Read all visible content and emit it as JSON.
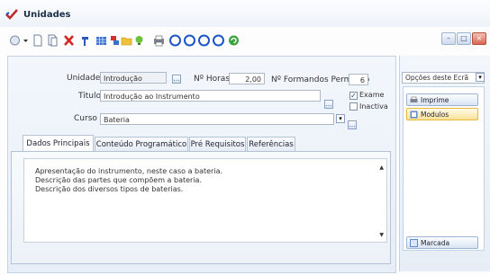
{
  "window": {
    "title": "Unidades"
  },
  "toolbar": {
    "icons": [
      "disc-icon",
      "dropdown-arrow-icon",
      "new-document-icon",
      "copy-document-icon",
      "delete-icon",
      "hammer-icon",
      "calendar-grid-icon",
      "report-icon",
      "folder-icon",
      "bulb-icon",
      "print-icon",
      "nav-first-icon",
      "nav-prev-icon",
      "nav-next-icon",
      "nav-last-icon",
      "refresh-icon"
    ]
  },
  "window_controls": {
    "minimize": "–",
    "maximize": "□",
    "close": "×"
  },
  "form": {
    "unidade_label": "Unidade",
    "unidade_value": "Introdução",
    "horas_label": "Nº Horas",
    "horas_value": "2,00",
    "formandos_label": "Nº Formandos Permitido",
    "formandos_value": "6",
    "titulo_label": "Titulo",
    "titulo_value": "Introdução ao Instrumento",
    "exame_label": "Exame",
    "exame_checked": true,
    "inactiva_label": "Inactiva",
    "inactiva_checked": false,
    "curso_label": "Curso",
    "curso_value": "Bateria"
  },
  "tabs": [
    {
      "label": "Dados Principais",
      "active": true
    },
    {
      "label": "Conteúdo Programático",
      "active": false
    },
    {
      "label": "Pré Requisitos",
      "active": false
    },
    {
      "label": "Referências",
      "active": false
    }
  ],
  "memo": {
    "lines": [
      "Apresentação do instrumento, neste caso a bateria.",
      "Descrição das partes que compõem a bateria.",
      "Descrição dos diversos tipos de baterias."
    ]
  },
  "side": {
    "options_label": "Opções deste Ecrã",
    "buttons": [
      "Imprime",
      "Modulos"
    ],
    "bottom_button": "Marcada"
  },
  "colors": {
    "accent": "#2f5fae",
    "toolbar_blue": "#1d56c6",
    "delete_red": "#d92323"
  }
}
